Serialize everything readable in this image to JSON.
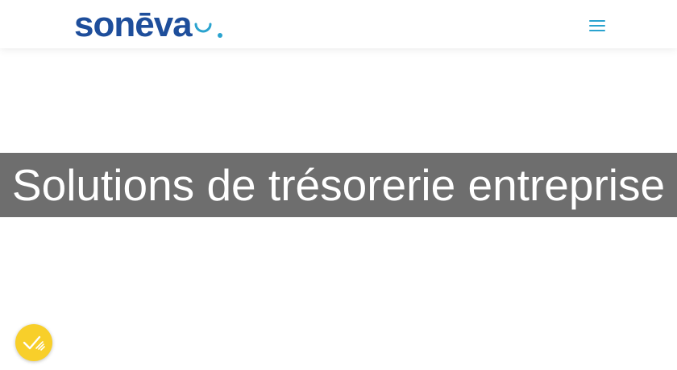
{
  "header": {
    "logo_text": "sonēva",
    "menu_icon": "hamburger-menu-icon"
  },
  "hero": {
    "title": "Solutions de trésorerie entreprise"
  },
  "cookie_widget": {
    "icon": "cookie-consent-check-icon",
    "color": "#f8cf2a"
  },
  "colors": {
    "brand_blue": "#1e4e9b",
    "accent_cyan": "#2aa3cf",
    "band_gray": "#5a5a5a"
  }
}
